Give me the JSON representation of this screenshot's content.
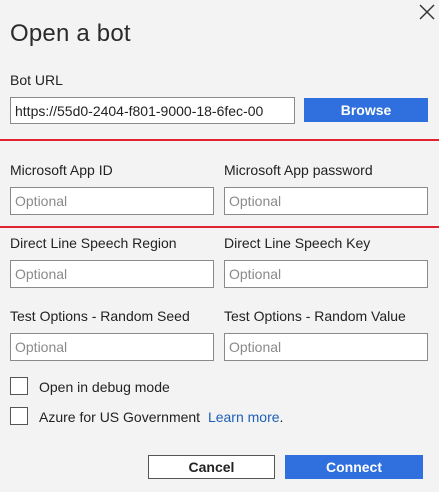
{
  "dialog": {
    "title": "Open a bot",
    "close_icon": "close-icon"
  },
  "bot_url": {
    "label": "Bot URL",
    "value": "https://55d0-2404-f801-9000-18-6fec-00",
    "browse_label": "Browse"
  },
  "app_id": {
    "label": "Microsoft App ID",
    "placeholder": "Optional"
  },
  "app_password": {
    "label": "Microsoft App password",
    "placeholder": "Optional"
  },
  "speech_region": {
    "label": "Direct Line Speech Region",
    "placeholder": "Optional"
  },
  "speech_key": {
    "label": "Direct Line Speech Key",
    "placeholder": "Optional"
  },
  "random_seed": {
    "label": "Test Options - Random Seed",
    "placeholder": "Optional"
  },
  "random_value": {
    "label": "Test Options - Random Value",
    "placeholder": "Optional"
  },
  "options": {
    "debug_label": "Open in debug mode",
    "gov_label": "Azure for US Government",
    "learn_more": "Learn more",
    "learn_more_suffix": "."
  },
  "actions": {
    "cancel_label": "Cancel",
    "connect_label": "Connect"
  },
  "colors": {
    "accent": "#2f6fde",
    "highlight_line": "#e0232e",
    "link": "#1d5fb8"
  }
}
